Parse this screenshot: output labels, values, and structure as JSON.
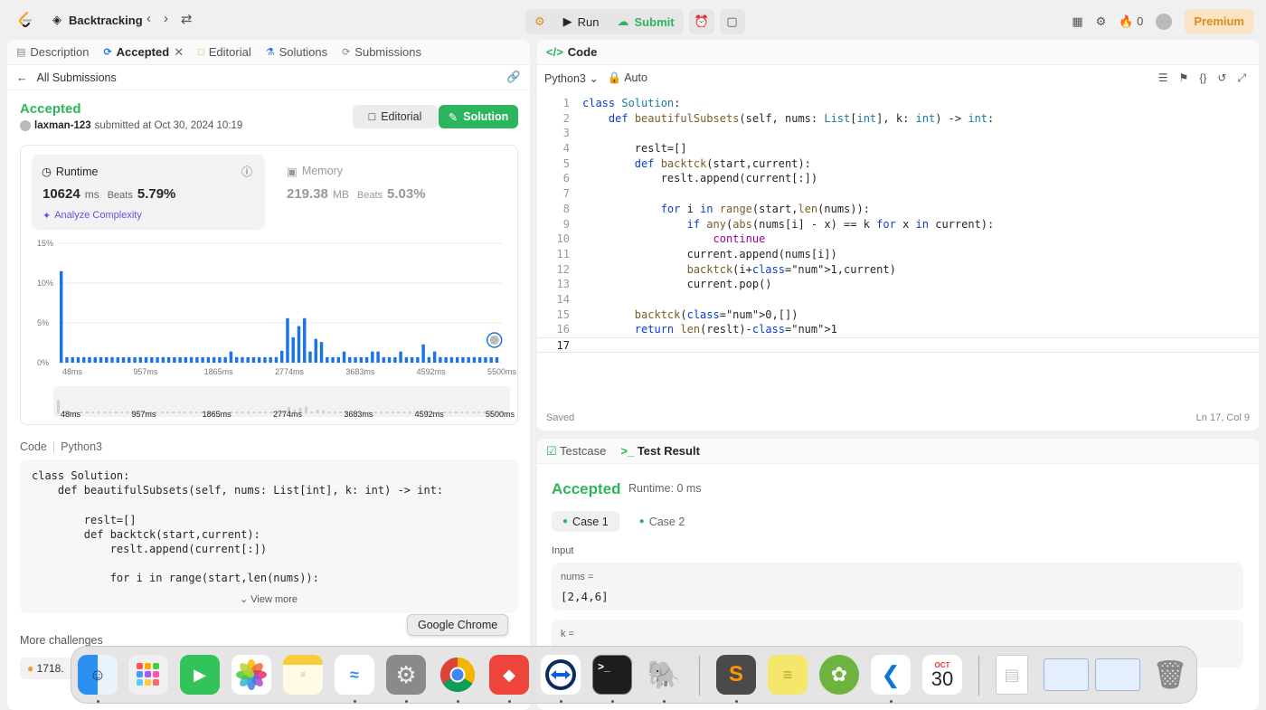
{
  "topbar": {
    "problem_title": "Backtracking",
    "run_label": "Run",
    "submit_label": "Submit",
    "streak_count": "0",
    "premium_label": "Premium"
  },
  "left": {
    "tabs": [
      {
        "label": "Description"
      },
      {
        "label": "Accepted"
      },
      {
        "label": "Editorial"
      },
      {
        "label": "Solutions"
      },
      {
        "label": "Submissions"
      }
    ],
    "all_submissions": "All Submissions",
    "status": "Accepted",
    "username": "laxman-123",
    "submitted_text": "submitted at Oct 30, 2024 10:19",
    "editorial_btn": "Editorial",
    "solution_btn": "Solution",
    "runtime": {
      "label": "Runtime",
      "value": "10624",
      "unit": "ms",
      "beats_label": "Beats",
      "beats_pct": "5.79%",
      "analyze": "Analyze Complexity"
    },
    "memory": {
      "label": "Memory",
      "value": "219.38",
      "unit": "MB",
      "beats_label": "Beats",
      "beats_pct": "5.03%"
    },
    "code_header": "Code",
    "code_lang": "Python3",
    "view_more": "View more",
    "more_challenges": "More challenges",
    "challenge_item": "1718."
  },
  "chart_data": {
    "type": "bar",
    "ylim": [
      0,
      15
    ],
    "yticks": [
      "15%",
      "10%",
      "5%",
      "0%"
    ],
    "xticks": [
      "48ms",
      "957ms",
      "1865ms",
      "2774ms",
      "3683ms",
      "4592ms",
      "5500ms"
    ],
    "values": [
      11.5,
      0.7,
      0.7,
      0.7,
      0.7,
      0.7,
      0.7,
      0.7,
      0.7,
      0.7,
      0.7,
      0.7,
      0.7,
      0.7,
      0.7,
      0.7,
      0.7,
      0.7,
      0.7,
      0.7,
      0.7,
      0.7,
      0.7,
      0.7,
      0.7,
      0.7,
      0.7,
      0.7,
      0.7,
      0.7,
      1.4,
      0.7,
      0.7,
      0.7,
      0.7,
      0.7,
      0.7,
      0.7,
      0.7,
      1.5,
      5.6,
      3.2,
      4.6,
      5.6,
      1.4,
      3.0,
      2.6,
      0.7,
      0.7,
      0.7,
      1.4,
      0.7,
      0.7,
      0.7,
      0.7,
      1.4,
      1.4,
      0.7,
      0.7,
      0.7,
      1.4,
      0.7,
      0.7,
      0.7,
      2.3,
      0.7,
      1.4,
      0.7,
      0.7,
      0.7,
      0.7,
      0.7,
      0.7,
      0.7,
      0.7,
      0.7,
      0.7,
      0.7
    ],
    "title": "",
    "xlabel": "",
    "ylabel": ""
  },
  "left_code": "class Solution:\n    def beautifulSubsets(self, nums: List[int], k: int) -> int:\n\n        reslt=[]\n        def backtck(start,current):\n            reslt.append(current[:])\n\n            for i in range(start,len(nums)):",
  "right": {
    "code_title": "Code",
    "language": "Python3",
    "mode": "Auto",
    "saved": "Saved",
    "cursor": "Ln 17, Col 9",
    "lines": [
      "class Solution:",
      "    def beautifulSubsets(self, nums: List[int], k: int) -> int:",
      "",
      "        reslt=[]",
      "        def backtck(start,current):",
      "            reslt.append(current[:])",
      "",
      "            for i in range(start,len(nums)):",
      "                if any(abs(nums[i] - x) == k for x in current):",
      "                    continue",
      "                current.append(nums[i])",
      "                backtck(i+1,current)",
      "                current.pop()",
      "",
      "        backtck(0,[])",
      "        return len(reslt)-1",
      ""
    ]
  },
  "result": {
    "testcase_tab": "Testcase",
    "result_tab": "Test Result",
    "status": "Accepted",
    "runtime": "Runtime: 0 ms",
    "case1": "Case 1",
    "case2": "Case 2",
    "input_label": "Input",
    "var1_name": "nums =",
    "var1_value": "[2,4,6]",
    "var2_name": "k ="
  },
  "dock": {
    "tooltip": "Google Chrome",
    "calendar_month": "OCT",
    "calendar_day": "30",
    "apps": [
      "finder",
      "launchpad",
      "facetime",
      "photos",
      "notes",
      "freeform",
      "system-settings",
      "google-chrome",
      "anydesk",
      "teamviewer",
      "terminal",
      "postgresql",
      "sublime-text",
      "stickies",
      "spring",
      "vscode",
      "calendar",
      "document",
      "chrome-window-1",
      "chrome-window-2",
      "trash"
    ]
  },
  "colors": {
    "accent_green": "#2db55d",
    "bar_blue": "#1a73e8",
    "premium_orange": "#d98f1b"
  }
}
